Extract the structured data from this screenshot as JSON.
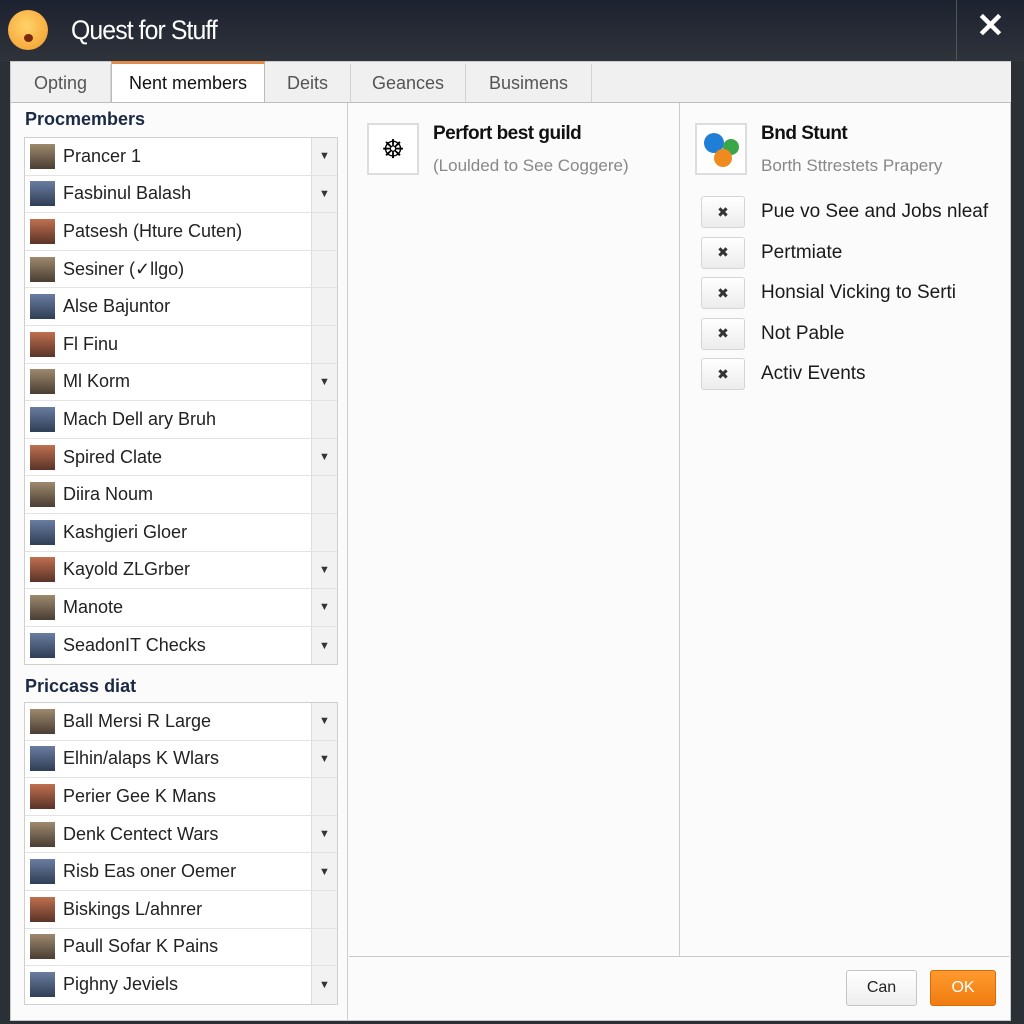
{
  "window": {
    "title": "Quest for Stuff",
    "close": "✕"
  },
  "tabs": [
    "Opting",
    "Nent members",
    "Deits",
    "Geances",
    "Busimens"
  ],
  "active_tab": "Nent members",
  "accent_color": "#f08a1e",
  "left": {
    "section1": "Procmembers",
    "members": [
      {
        "name": "Prancer 1",
        "dropdown": true
      },
      {
        "name": "Fasbinul Balash",
        "dropdown": true
      },
      {
        "name": "Patsesh (Hture Cuten)",
        "dropdown": false
      },
      {
        "name": "Sesiner (✓llgo)",
        "dropdown": false
      },
      {
        "name": "Alse Bajuntor",
        "dropdown": false
      },
      {
        "name": "Fl Finu",
        "dropdown": false
      },
      {
        "name": "Ml Korm",
        "dropdown": true
      },
      {
        "name": "Mach Dell ary Bruh",
        "dropdown": false
      },
      {
        "name": "Spired Clate",
        "dropdown": true
      },
      {
        "name": "Diira Noum",
        "dropdown": false
      },
      {
        "name": "Kashgieri Gloer",
        "dropdown": false
      },
      {
        "name": "Kayold ZLGrber",
        "dropdown": true
      },
      {
        "name": "Manote",
        "dropdown": true
      },
      {
        "name": "SeadonIT Checks",
        "dropdown": true
      }
    ],
    "section2": "Priccass diat",
    "members2": [
      {
        "name": "Ball Mersi R Large",
        "dropdown": true
      },
      {
        "name": "Elhin/alaps K Wlars",
        "dropdown": true
      },
      {
        "name": "Perier Gee K Mans",
        "dropdown": false
      },
      {
        "name": "Denk Centect Wars",
        "dropdown": true
      },
      {
        "name": "Risb Eas oner Oemer",
        "dropdown": true
      },
      {
        "name": "Biskings L/ahnrer",
        "dropdown": false
      },
      {
        "name": "Paull Sofar K Pains",
        "dropdown": false
      },
      {
        "name": "Pighny Jeviels",
        "dropdown": true
      }
    ]
  },
  "middle": {
    "title": "Perfort best guild",
    "subtitle": "(Loulded to See Coggere)",
    "icon": "guild-icon"
  },
  "right": {
    "title": "Bnd Stunt",
    "subtitle": "Borth Sttrestets Prapery",
    "icon": "chat-bubbles-icon",
    "options": [
      "Pue vo See and Jobs nleaf",
      "Pertmiate",
      "Honsial Vicking to Serti",
      "Not Pable",
      "Activ Events"
    ]
  },
  "footer": {
    "cancel": "Can",
    "ok": "OK"
  }
}
